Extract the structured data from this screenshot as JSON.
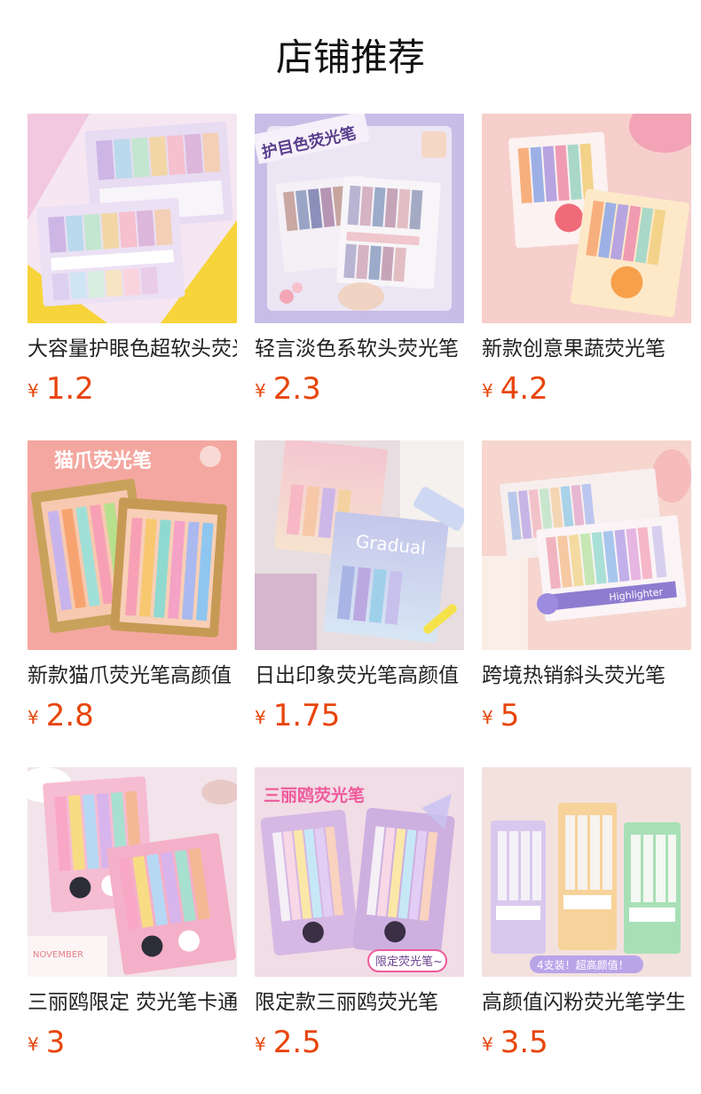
{
  "header": {
    "title": "店铺推荐"
  },
  "colors": {
    "price": "#e8450b",
    "title": "#111111"
  },
  "products": [
    {
      "name": "大容量护眼色超软头荧光笔",
      "currency": "¥",
      "price": "1.2",
      "image_icon": "pastel-highlighter-box-image"
    },
    {
      "name": "轻言淡色系软头荧光笔",
      "currency": "¥",
      "price": "2.3",
      "image_icon": "eye-care-highlighter-image",
      "image_caption": "护目色荧光笔"
    },
    {
      "name": "新款创意果蔬荧光笔",
      "currency": "¥",
      "price": "4.2",
      "image_icon": "fruit-highlighter-image"
    },
    {
      "name": "新款猫爪荧光笔高颜值",
      "currency": "¥",
      "price": "2.8",
      "image_icon": "cat-paw-highlighter-image",
      "image_caption": "猫爪荧光笔"
    },
    {
      "name": "日出印象荧光笔高颜值",
      "currency": "¥",
      "price": "1.75",
      "image_icon": "gradual-highlighter-image",
      "image_caption": "Gradual"
    },
    {
      "name": "跨境热销斜头荧光笔",
      "currency": "¥",
      "price": "5",
      "image_icon": "slanted-highlighter-image",
      "image_caption": "Highlighter"
    },
    {
      "name": "三丽鸥限定 荧光笔卡通",
      "currency": "¥",
      "price": "3",
      "image_icon": "sanrio-highlighter-image",
      "image_caption": "NOVEMBER"
    },
    {
      "name": "限定款三丽鸥荧光笔",
      "currency": "¥",
      "price": "2.5",
      "image_icon": "sanrio-bag-highlighter-image",
      "image_caption": "三丽鸥荧光笔",
      "image_caption_2": "限定荧光笔~"
    },
    {
      "name": "高颜值闪粉荧光笔学生",
      "currency": "¥",
      "price": "3.5",
      "image_icon": "shiny-pen-highlighter-image",
      "image_caption": "4支装！超高颜值！"
    }
  ]
}
